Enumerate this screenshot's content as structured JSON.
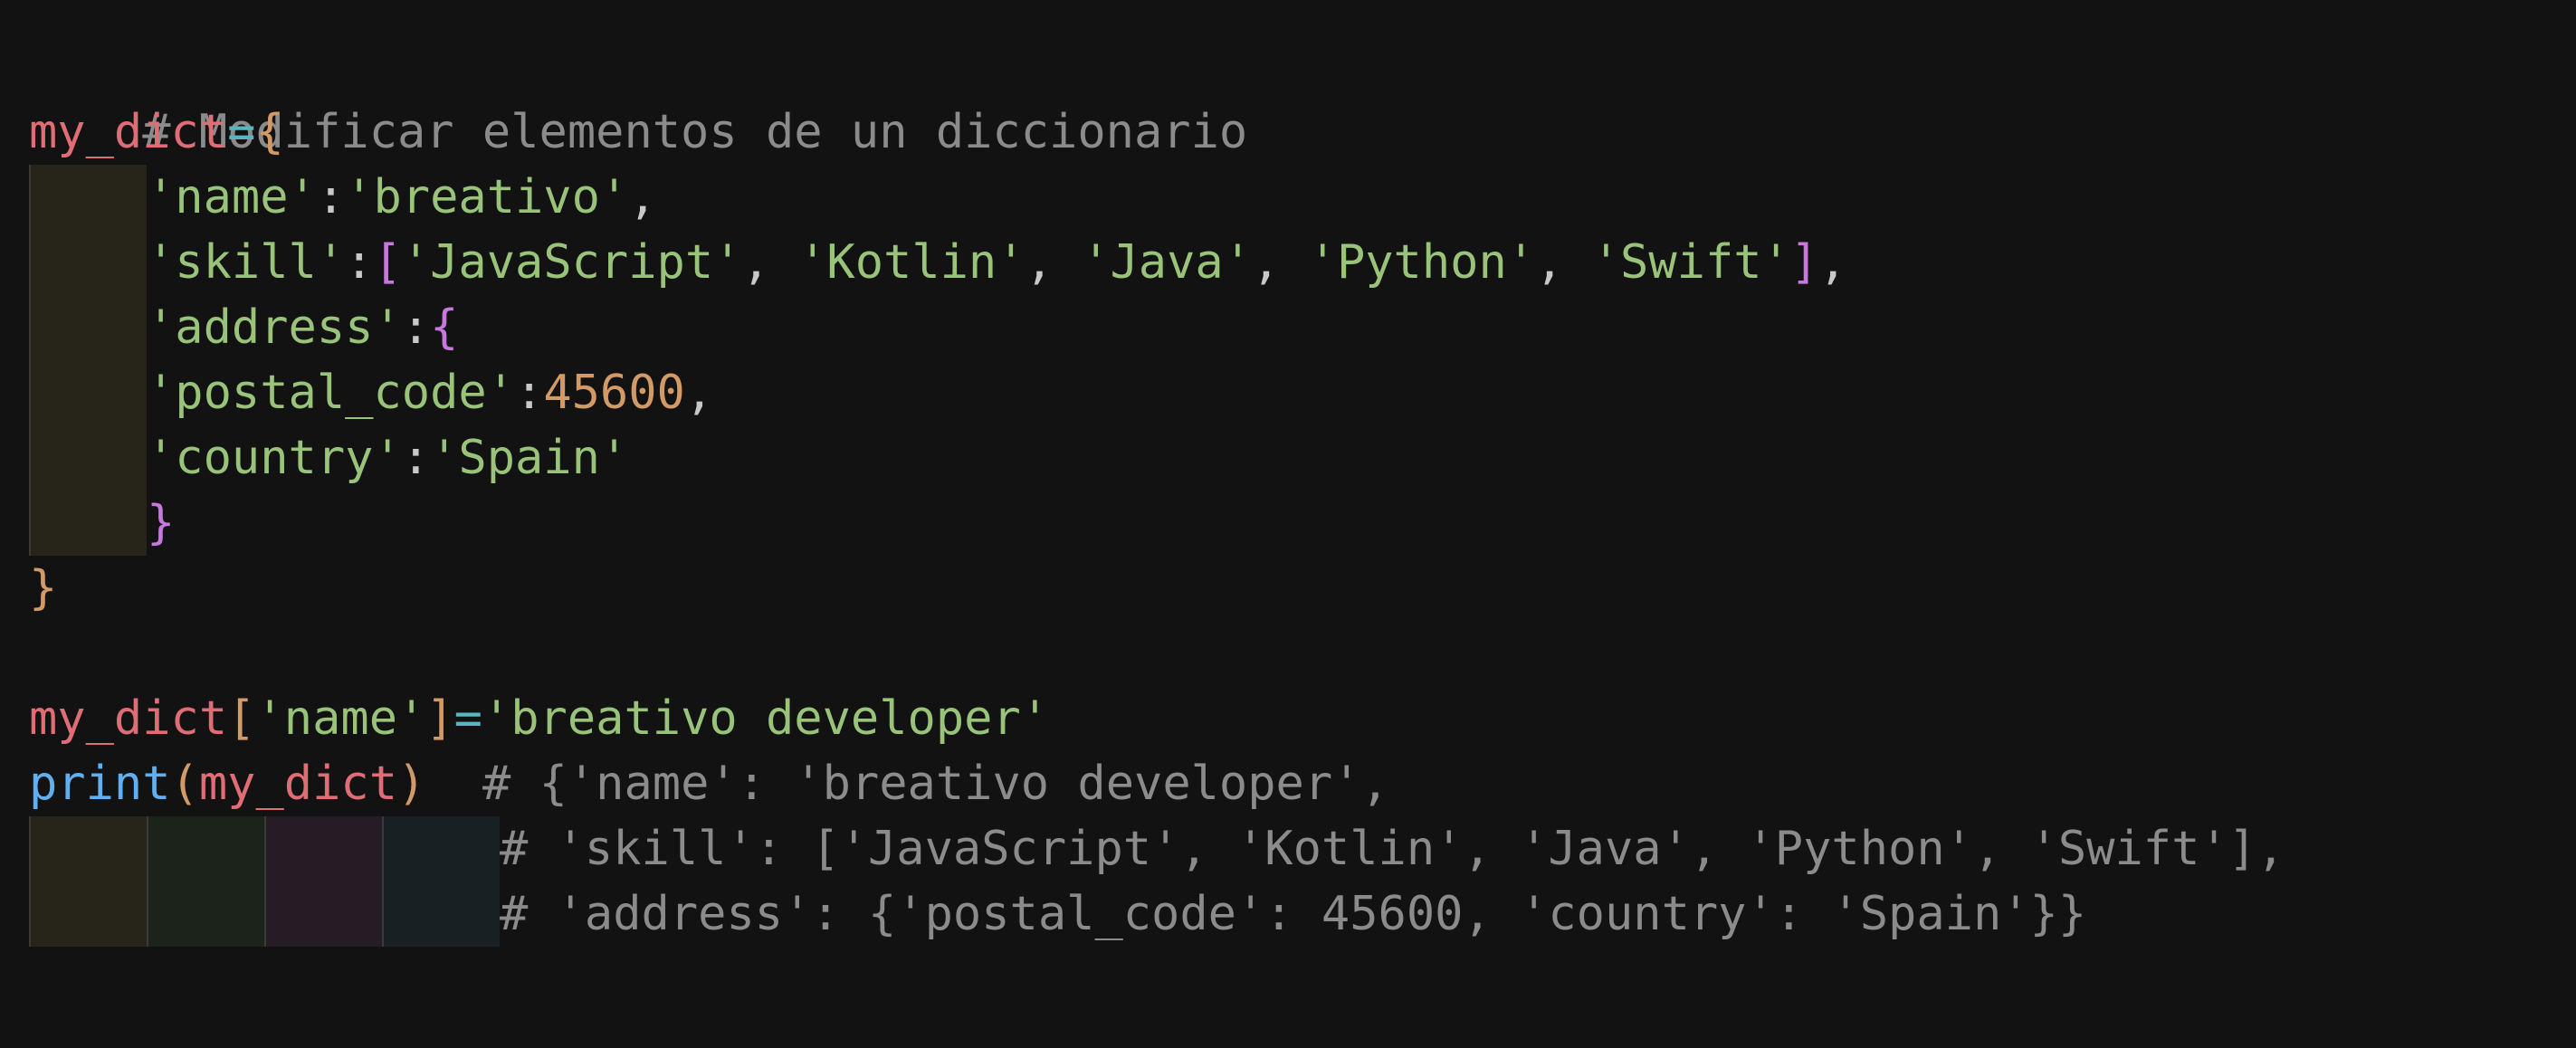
{
  "comment_title": "# Modificar elementos de un diccionario",
  "tokens": {
    "var": "my_dict",
    "assign": "=",
    "open_brace": "{",
    "close_brace": "}",
    "open_bracket": "[",
    "close_bracket": "]",
    "colon": ":",
    "comma": ",",
    "comma_space": ", ",
    "key_name": "'name'",
    "val_name": "'breativo'",
    "key_skill": "'skill'",
    "skills": [
      "'JavaScript'",
      "'Kotlin'",
      "'Java'",
      "'Python'",
      "'Swift'"
    ],
    "key_address": "'address'",
    "key_postal": "'postal_code'",
    "val_postal": "45600",
    "key_country": "'country'",
    "val_country": "'Spain'",
    "new_name": "'breativo developer'",
    "print_fn": "print",
    "open_paren": "(",
    "close_paren": ")"
  },
  "output_comments": [
    "# {'name': 'breativo developer',",
    "# 'skill': ['JavaScript', 'Kotlin', 'Java', 'Python', 'Swift'],",
    "# 'address': {'postal_code': 45600, 'country': 'Spain'}}"
  ],
  "colors": {
    "background": "#121212",
    "comment": "#8b8b8b",
    "variable": "#e06c75",
    "operator": "#56b6c2",
    "string": "#98c379",
    "number": "#d19a66",
    "bracket_level1": "#d19a66",
    "bracket_level2": "#c678dd",
    "function": "#61afef"
  }
}
